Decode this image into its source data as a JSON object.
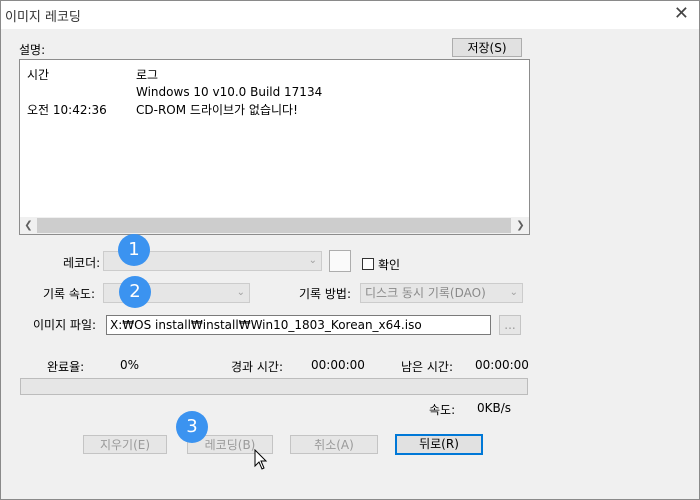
{
  "window": {
    "title": "이미지 레코딩",
    "close_glyph": "✕"
  },
  "description_label": "설명:",
  "save_button": "저장(S)",
  "log": {
    "headers": [
      "시간",
      "로그"
    ],
    "rows": [
      {
        "time": "",
        "log": "Windows 10 v10.0 Build 17134"
      },
      {
        "time": "오전 10:42:36",
        "log": "CD-ROM 드라이브가 없습니다!"
      }
    ]
  },
  "recorder": {
    "label": "레코더:",
    "value": "",
    "confirm_label": "확인",
    "confirm_checked": false
  },
  "speed": {
    "label": "기록 속도:",
    "value": ""
  },
  "method": {
    "label": "기록 방법:",
    "value": "디스크 동시 기록(DAO)"
  },
  "image_file": {
    "label": "이미지 파일:",
    "value": "X:₩OS install₩install₩Win10_1803_Korean_x64.iso",
    "browse_label": "..."
  },
  "status": {
    "complete_label": "완료율:",
    "complete_value": "0%",
    "elapsed_label": "경과 시간:",
    "elapsed_value": "00:00:00",
    "remaining_label": "남은 시간:",
    "remaining_value": "00:00:00",
    "progress_fraction": 0,
    "speed_label": "속도:",
    "speed_value": "0KB/s"
  },
  "buttons": {
    "clear": "지우기(E)",
    "record": "레코딩(B)",
    "cancel": "취소(A)",
    "back": "뒤로(R)"
  },
  "badges": [
    "1",
    "2",
    "3"
  ],
  "colors": {
    "badge": "#3b93f0",
    "default_button_border": "#0078d7"
  }
}
